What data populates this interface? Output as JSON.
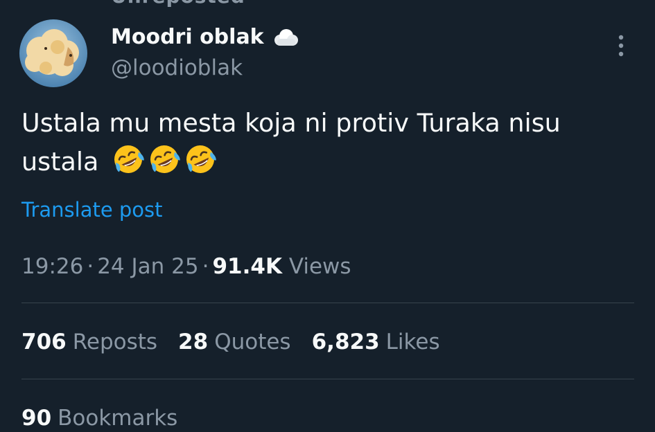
{
  "header": {
    "cutoff_text": "Unreposted"
  },
  "author": {
    "display_name": "Moodri oblak",
    "name_icon": "cloud-icon",
    "handle": "@loodioblak",
    "avatar_icon": "avatar"
  },
  "post": {
    "text": "Ustala mu mesta koja ni protiv Turaka nisu ustala",
    "emoji": [
      "rolling-on-floor-laughing-icon",
      "rolling-on-floor-laughing-icon",
      "rolling-on-floor-laughing-icon"
    ],
    "translate_label": "Translate post"
  },
  "meta": {
    "time": "19:26",
    "separator": "·",
    "date": "24 Jan 25",
    "views_count": "91.4K",
    "views_label": "Views"
  },
  "stats": {
    "reposts_count": "706",
    "reposts_label": "Reposts",
    "quotes_count": "28",
    "quotes_label": "Quotes",
    "likes_count": "6,823",
    "likes_label": "Likes",
    "bookmarks_count": "90",
    "bookmarks_label": "Bookmarks"
  },
  "colors": {
    "background": "#15202b",
    "text_primary": "#f7f9f9",
    "text_secondary": "#8b98a5",
    "link": "#1d9bf0",
    "divider": "#38444d"
  }
}
